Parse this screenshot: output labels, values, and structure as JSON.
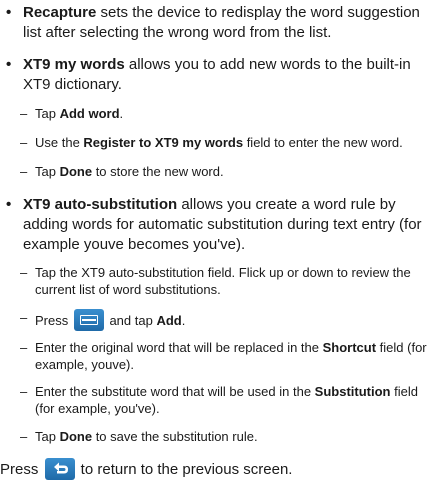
{
  "bullets": {
    "recapture": {
      "term": "Recapture",
      "text": " sets the device to redisplay the word suggestion list after selecting the wrong word from the list."
    },
    "my_words": {
      "term": "XT9 my words",
      "text": " allows you to add new words to the built-in XT9 dictionary.",
      "steps": [
        {
          "pre": "Tap ",
          "bold": "Add word",
          "post": "."
        },
        {
          "pre": "Use the ",
          "bold": "Register to XT9 my words",
          "post": " field to enter the new word."
        },
        {
          "pre": "Tap ",
          "bold": "Done",
          "post": " to store the new word."
        }
      ]
    },
    "auto_sub": {
      "term": "XT9 auto-substitution",
      "text": " allows you create a word rule by adding words for automatic substitution during text entry (for example youve becomes you've).",
      "step1": "Tap the XT9 auto-substitution field. Flick up or down to review the current list of word substitutions.",
      "step2_pre": "Press ",
      "step2_mid": " and tap ",
      "step2_bold": "Add",
      "step2_post": ".",
      "step3_pre": "Enter the original word that will be replaced in the ",
      "step3_bold": "Shortcut",
      "step3_post": " field (for example, youve).",
      "step4_pre": "Enter the substitute word that will be used in the ",
      "step4_bold": "Substitution",
      "step4_post": " field (for example, you've).",
      "step5_pre": "Tap ",
      "step5_bold": "Done",
      "step5_post": " to save the substitution rule."
    }
  },
  "footer": {
    "pre": "Press ",
    "post": " to return to the previous screen."
  },
  "symbols": {
    "bullet": "•",
    "dash": "–"
  },
  "icons": {
    "menu": "menu-key-icon",
    "back": "back-key-icon"
  },
  "colors": {
    "icon_blue": "#2a7fc0"
  }
}
